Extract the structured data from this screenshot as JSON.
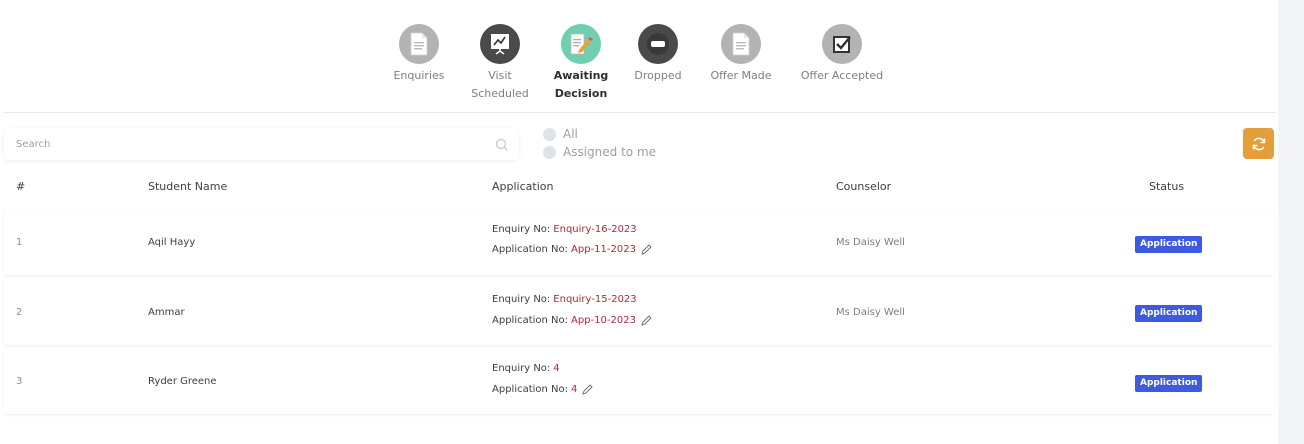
{
  "stages": [
    {
      "label_lines": [
        "Enquiries"
      ],
      "icon": "document-icon",
      "active": false
    },
    {
      "label_lines": [
        "Visit",
        "Scheduled"
      ],
      "icon": "presentation-board-icon",
      "active": false
    },
    {
      "label_lines": [
        "Awaiting",
        "Decision"
      ],
      "icon": "document-edit-icon",
      "active": true
    },
    {
      "label_lines": [
        "Dropped"
      ],
      "icon": "minus-circle-icon",
      "active": false
    },
    {
      "label_lines": [
        "Offer Made"
      ],
      "icon": "document-icon",
      "active": false
    },
    {
      "label_lines": [
        "Offer Accepted"
      ],
      "icon": "checkbox-icon",
      "active": false
    }
  ],
  "search": {
    "placeholder": "Search"
  },
  "filters": {
    "all_label": "All",
    "assigned_label": "Assigned to me"
  },
  "table": {
    "headers": {
      "num": "#",
      "student": "Student Name",
      "application": "Application",
      "counselor": "Counselor",
      "status": "Status"
    },
    "enquiry_label": "Enquiry No:",
    "application_label": "Application No:",
    "rows": [
      {
        "num": "1",
        "student": "Aqil Hayy",
        "enquiry_no": "Enquiry-16-2023",
        "application_no": "App-11-2023",
        "counselor": "Ms Daisy Well",
        "status": "Application"
      },
      {
        "num": "2",
        "student": "Ammar",
        "enquiry_no": "Enquiry-15-2023",
        "application_no": "App-10-2023",
        "counselor": "Ms Daisy Well",
        "status": "Application"
      },
      {
        "num": "3",
        "student": "Ryder Greene",
        "enquiry_no": "4",
        "application_no": "4",
        "counselor": "",
        "status": "Application"
      }
    ]
  },
  "colors": {
    "accent_orange": "#e59e3c",
    "status_blue": "#3d5ae0",
    "value_red": "#b02a37",
    "active_green": "#6fcfb0"
  }
}
